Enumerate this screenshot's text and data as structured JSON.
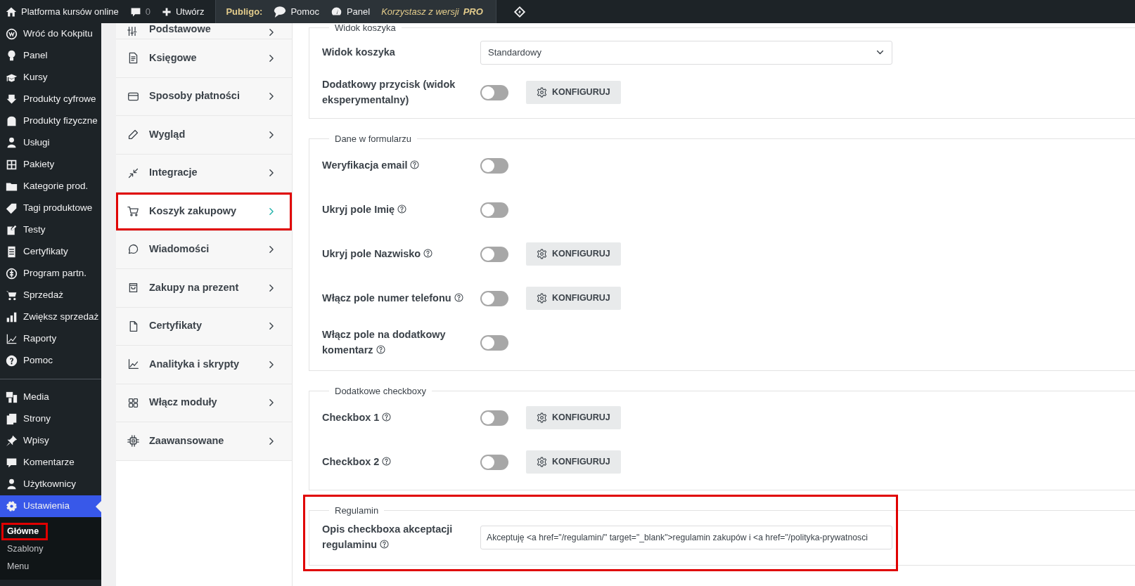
{
  "top_bar": {
    "site_name": "Platforma kursów online",
    "comment_count": "0",
    "new_label": "Utwórz",
    "brand": "Publigo:",
    "help_label": "Pomoc",
    "panel_label": "Panel",
    "version_note": "Korzystasz z wersji **PRO**"
  },
  "sidebar": {
    "groups": [
      [
        {
          "label": "Wróć do Kokpitu",
          "selected": false
        },
        {
          "label": "Panel",
          "selected": false
        },
        {
          "label": "Kursy",
          "selected": false
        },
        {
          "label": "Produkty cyfrowe",
          "selected": false
        },
        {
          "label": "Produkty fizyczne",
          "selected": false
        },
        {
          "label": "Usługi",
          "selected": false
        },
        {
          "label": "Pakiety",
          "selected": false
        },
        {
          "label": "Kategorie prod.",
          "selected": false
        },
        {
          "label": "Tagi produktowe",
          "selected": false
        },
        {
          "label": "Testy",
          "selected": false
        },
        {
          "label": "Certyfikaty",
          "selected": false
        },
        {
          "label": "Program partn.",
          "selected": false
        },
        {
          "label": "Sprzedaż",
          "selected": false
        },
        {
          "label": "Zwiększ sprzedaż",
          "selected": false
        },
        {
          "label": "Raporty",
          "selected": false
        },
        {
          "label": "Pomoc",
          "selected": false
        }
      ],
      [
        {
          "label": "Media",
          "selected": false
        },
        {
          "label": "Strony",
          "selected": false
        },
        {
          "label": "Wpisy",
          "selected": false
        },
        {
          "label": "Komentarze",
          "selected": false
        },
        {
          "label": "Użytkownicy",
          "selected": false
        },
        {
          "label": "Ustawienia",
          "selected": true,
          "submenu": [
            {
              "label": "Główne",
              "selected": true,
              "highlighted": true
            },
            {
              "label": "Szablony",
              "selected": false,
              "highlighted": false
            },
            {
              "label": "Menu",
              "selected": false,
              "highlighted": false
            }
          ]
        }
      ]
    ]
  },
  "settings_nav": [
    {
      "label": "Podstawowe",
      "selected": false,
      "highlighted": false
    },
    {
      "label": "Księgowe",
      "selected": false,
      "highlighted": false
    },
    {
      "label": "Sposoby płatności",
      "selected": false,
      "highlighted": false
    },
    {
      "label": "Wygląd",
      "selected": false,
      "highlighted": false
    },
    {
      "label": "Integracje",
      "selected": false,
      "highlighted": false
    },
    {
      "label": "Koszyk zakupowy",
      "selected": true,
      "highlighted": true
    },
    {
      "label": "Wiadomości",
      "selected": false,
      "highlighted": false
    },
    {
      "label": "Zakupy na prezent",
      "selected": false,
      "highlighted": false
    },
    {
      "label": "Certyfikaty",
      "selected": false,
      "highlighted": false
    },
    {
      "label": "Analityka i skrypty",
      "selected": false,
      "highlighted": false
    },
    {
      "label": "Włącz moduły",
      "selected": false,
      "highlighted": false
    },
    {
      "label": "Zaawansowane",
      "selected": false,
      "highlighted": false
    }
  ],
  "sections": [
    {
      "legend": "Widok koszyka",
      "highlighted": false,
      "rows": [
        {
          "kind": "select",
          "label": "Widok koszyka",
          "help": false,
          "value": "Standardowy"
        },
        {
          "kind": "toggle",
          "label": "Dodatkowy przycisk (widok eksperymentalny)",
          "help": false,
          "on": false,
          "button": "KONFIGURUJ"
        }
      ]
    },
    {
      "legend": "Dane w formularzu",
      "highlighted": false,
      "rows": [
        {
          "kind": "toggle",
          "label": "Weryfikacja email",
          "help": true,
          "on": false
        },
        {
          "kind": "toggle",
          "label": "Ukryj pole Imię",
          "help": true,
          "on": false
        },
        {
          "kind": "toggle",
          "label": "Ukryj pole Nazwisko",
          "help": true,
          "on": false,
          "button": "KONFIGURUJ"
        },
        {
          "kind": "toggle",
          "label": "Włącz pole numer telefonu",
          "help": true,
          "on": false,
          "button": "KONFIGURUJ"
        },
        {
          "kind": "toggle",
          "label": "Włącz pole na dodatkowy komentarz",
          "help": true,
          "on": false
        }
      ]
    },
    {
      "legend": "Dodatkowe checkboxy",
      "highlighted": false,
      "rows": [
        {
          "kind": "toggle",
          "label": "Checkbox 1",
          "help": true,
          "on": false,
          "button": "KONFIGURUJ"
        },
        {
          "kind": "toggle",
          "label": "Checkbox 2",
          "help": true,
          "on": false,
          "button": "KONFIGURUJ"
        }
      ]
    },
    {
      "legend": "Regulamin",
      "highlighted": true,
      "rows": [
        {
          "kind": "text",
          "label": "Opis checkboxa akceptacji regulaminu",
          "help": true,
          "value": "Akceptuję <a href=\"/regulamin/\" target=\"_blank\">regulamin zakupów i <a href=\"/polityka-prywatnosci"
        }
      ]
    }
  ]
}
